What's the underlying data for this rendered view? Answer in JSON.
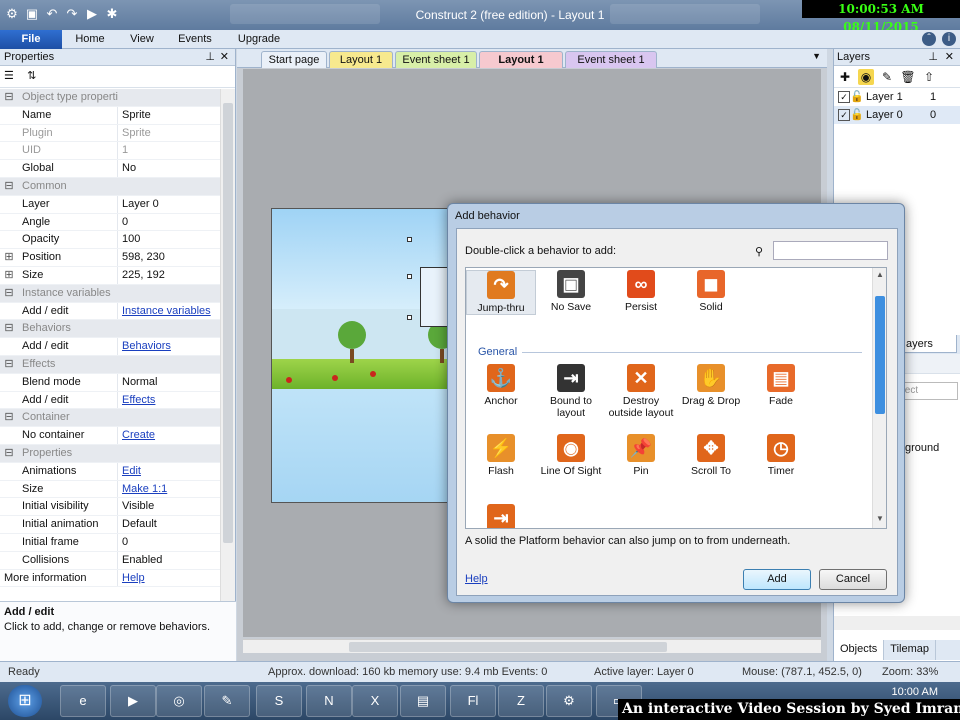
{
  "window": {
    "title": "Construct 2  (free edition) - Layout 1"
  },
  "overlay": {
    "clock": "10:00:53 AM 08/11/2015",
    "banner": "An interactive Video Session by Syed Imran Ali"
  },
  "ribbon": {
    "file": "File",
    "tabs": [
      "Home",
      "View",
      "Events",
      "Upgrade"
    ]
  },
  "properties": {
    "title": "Properties",
    "rows": [
      {
        "type": "cat",
        "label": "Object type properties"
      },
      {
        "k": "Name",
        "v": "Sprite"
      },
      {
        "k": "Plugin",
        "v": "Sprite",
        "dim": true
      },
      {
        "k": "UID",
        "v": "1",
        "dim": true
      },
      {
        "k": "Global",
        "v": "No"
      },
      {
        "type": "cat",
        "label": "Common"
      },
      {
        "k": "Layer",
        "v": "Layer 0"
      },
      {
        "k": "Angle",
        "v": "0"
      },
      {
        "k": "Opacity",
        "v": "100"
      },
      {
        "k": "Position",
        "v": "598, 230",
        "exp": "+"
      },
      {
        "k": "Size",
        "v": "225, 192",
        "exp": "+"
      },
      {
        "type": "cat",
        "label": "Instance variables"
      },
      {
        "k": "Add / edit",
        "v": "Instance variables",
        "link": true
      },
      {
        "type": "cat",
        "label": "Behaviors"
      },
      {
        "k": "Add / edit",
        "v": "Behaviors",
        "link": true
      },
      {
        "type": "cat",
        "label": "Effects"
      },
      {
        "k": "Blend mode",
        "v": "Normal"
      },
      {
        "k": "Add / edit",
        "v": "Effects",
        "link": true
      },
      {
        "type": "cat",
        "label": "Container"
      },
      {
        "k": "No container",
        "v": "Create",
        "link": true
      },
      {
        "type": "cat",
        "label": "Properties"
      },
      {
        "k": "Animations",
        "v": "Edit",
        "link": true
      },
      {
        "k": "Size",
        "v": "Make 1:1",
        "link": true
      },
      {
        "k": "Initial visibility",
        "v": "Visible"
      },
      {
        "k": "Initial animation",
        "v": "Default"
      },
      {
        "k": "Initial frame",
        "v": "0"
      },
      {
        "k": "Collisions",
        "v": "Enabled"
      },
      {
        "k": "More information",
        "v": "Help",
        "link": true,
        "flush": true
      }
    ],
    "desc_title": "Add / edit",
    "desc_text": "Click to add, change or remove behaviors."
  },
  "doc_tabs": [
    {
      "label": "Start page",
      "color": "#eaf0f8"
    },
    {
      "label": "Layout 1",
      "color": "#f7e98e"
    },
    {
      "label": "Event sheet 1",
      "color": "#d8efa8"
    },
    {
      "label": "Layout 1",
      "color": "#f6c9cf",
      "active": true
    },
    {
      "label": "Event sheet 1",
      "color": "#d9c6f0"
    }
  ],
  "layers": {
    "title": "Layers",
    "rows": [
      {
        "name": "Layer 1",
        "num": "1"
      },
      {
        "name": "Layer 0",
        "num": "0"
      }
    ]
  },
  "project_tab_partial": "ayers",
  "objects": {
    "search_placeholder": "bject",
    "item_partial": "ckground",
    "tabs": [
      "Objects",
      "Tilemap"
    ]
  },
  "status": {
    "ready": "Ready",
    "download": "Approx. download: 160 kb  memory use: 9.4 mb  Events: 0",
    "active_layer": "Active layer: Layer 0",
    "mouse": "Mouse: (787.1, 452.5, 0)",
    "zoom": "Zoom: 33%"
  },
  "taskbar": {
    "time": "10:00 AM"
  },
  "dialog": {
    "title": "Add behavior",
    "hint": "Double-click a behavior to add:",
    "group": "General",
    "top_row": [
      {
        "label": "Jump-thru",
        "icon": "jump-thru-icon",
        "color": "#e07a1f",
        "selected": true
      },
      {
        "label": "No Save",
        "icon": "no-save-icon",
        "color": "#444444"
      },
      {
        "label": "Persist",
        "icon": "persist-icon",
        "color": "#e14b1b"
      },
      {
        "label": "Solid",
        "icon": "solid-icon",
        "color": "#e8662a"
      }
    ],
    "general_row1": [
      {
        "label": "Anchor",
        "icon": "anchor-icon",
        "color": "#e0661b"
      },
      {
        "label": "Bound to\nlayout",
        "icon": "bound-to-layout-icon",
        "color": "#333333"
      },
      {
        "label": "Destroy\noutside layout",
        "icon": "destroy-outside-layout-icon",
        "color": "#e0661b"
      },
      {
        "label": "Drag & Drop",
        "icon": "drag-drop-icon",
        "color": "#e8902a"
      },
      {
        "label": "Fade",
        "icon": "fade-icon",
        "color": "#e86a2a"
      }
    ],
    "general_row2": [
      {
        "label": "Flash",
        "icon": "flash-icon",
        "color": "#e8902a"
      },
      {
        "label": "Line Of Sight",
        "icon": "line-of-sight-icon",
        "color": "#e0661b"
      },
      {
        "label": "Pin",
        "icon": "pin-icon",
        "color": "#e8902a"
      },
      {
        "label": "Scroll To",
        "icon": "scroll-to-icon",
        "color": "#e0661b"
      },
      {
        "label": "Timer",
        "icon": "timer-icon",
        "color": "#e0661b"
      }
    ],
    "description": "A solid the Platform behavior can also jump on to from underneath.",
    "help": "Help",
    "add": "Add",
    "cancel": "Cancel"
  }
}
